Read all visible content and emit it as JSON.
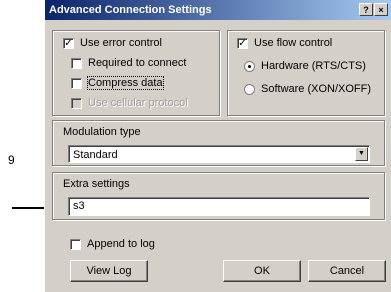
{
  "callout": {
    "number": "9"
  },
  "dialog": {
    "title": "Advanced Connection Settings",
    "title_buttons": [
      "?",
      "×"
    ],
    "error_control": {
      "label": "Use error control",
      "checked": true
    },
    "required_to_connect": {
      "label": "Required to connect",
      "checked": false
    },
    "compress_data": {
      "label": "Compress data",
      "checked": false
    },
    "cellular_protocol": {
      "label": "Use cellular protocol",
      "checked": false,
      "enabled": false
    },
    "flow_control": {
      "label": "Use flow control",
      "checked": true
    },
    "hardware": {
      "label": "Hardware (RTS/CTS)",
      "selected": true
    },
    "software": {
      "label": "Software (XON/XOFF)",
      "selected": false
    },
    "modulation": {
      "label": "Modulation type",
      "value": "Standard"
    },
    "extra_settings": {
      "label": "Extra settings",
      "value": "s3"
    },
    "append_to_log": {
      "label": "Append to log",
      "checked": false
    },
    "buttons": {
      "view_log": "View Log",
      "ok": "OK",
      "cancel": "Cancel"
    }
  }
}
